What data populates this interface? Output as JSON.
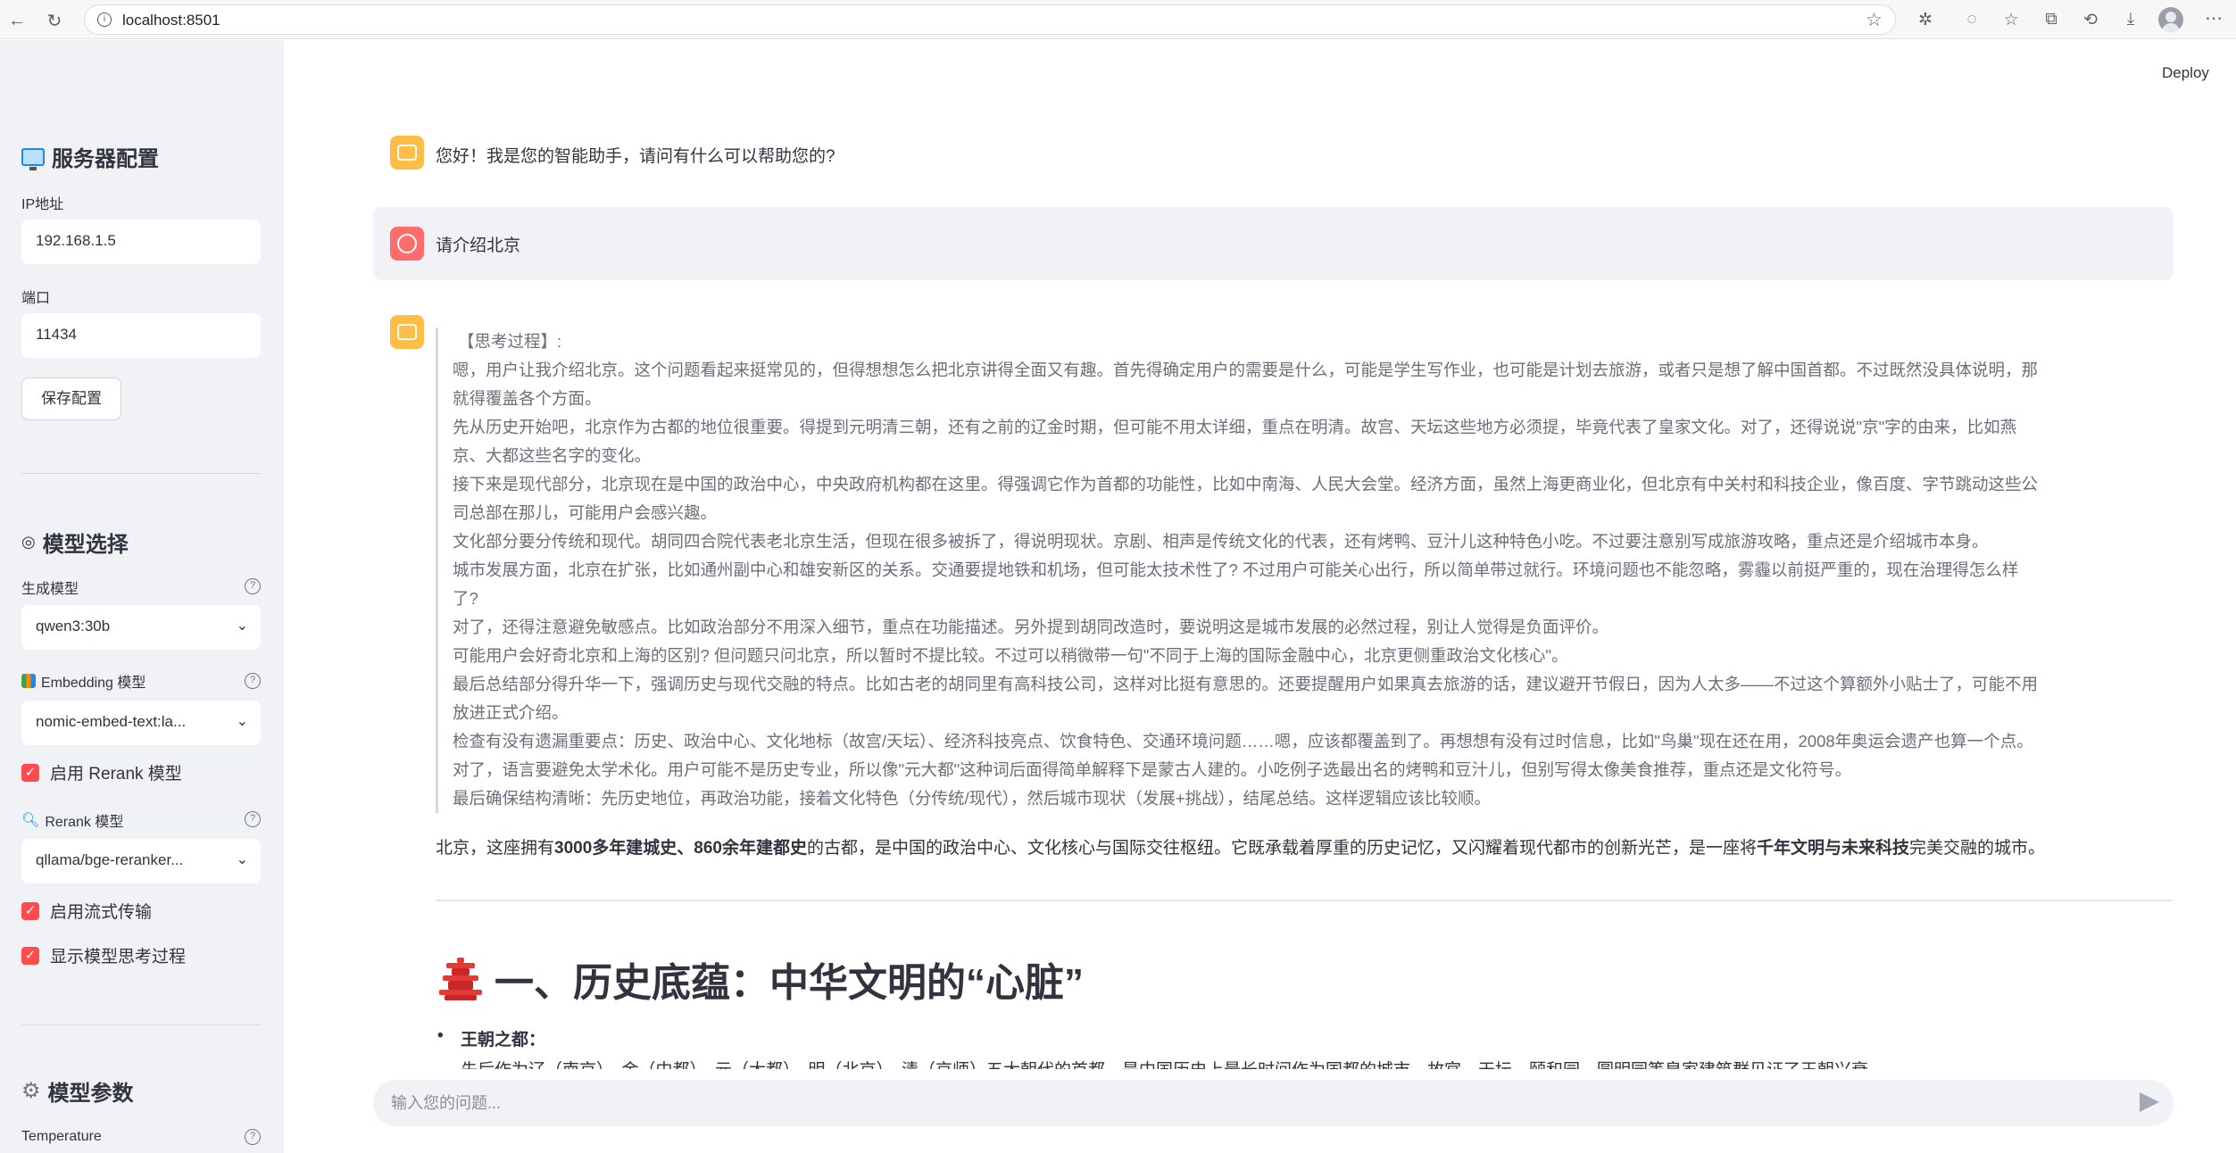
{
  "browser": {
    "url": "localhost:8501",
    "icons": [
      "back-icon",
      "reload-icon",
      "info-icon",
      "star-icon",
      "extensions-icon",
      "copilot-icon",
      "favorites-icon",
      "collections-icon",
      "history-icon",
      "downloads-icon",
      "profile-icon",
      "more-icon"
    ]
  },
  "header": {
    "deploy_label": "Deploy"
  },
  "sidebar": {
    "server_title": "服务器配置",
    "ip_label": "IP地址",
    "ip_value": "192.168.1.5",
    "port_label": "端口",
    "port_value": "11434",
    "save_label": "保存配置",
    "model_title": "模型选择",
    "gen_model_label": "生成模型",
    "gen_model_value": "qwen3:30b",
    "embed_label": "Embedding 模型",
    "embed_value": "nomic-embed-text:la...",
    "rerank_enable_label": "启用 Rerank 模型",
    "rerank_label": "Rerank 模型",
    "rerank_value": "qllama/bge-reranker...",
    "stream_label": "启用流式传输",
    "show_think_label": "显示模型思考过程",
    "params_title": "模型参数",
    "temperature_label": "Temperature"
  },
  "chat": {
    "greeting": "您好！我是您的智能助手，请问有什么可以帮助您的?",
    "user_msg": "请介绍北京",
    "think_lines": [
      "【思考过程】:",
      "嗯，用户让我介绍北京。这个问题看起来挺常见的，但得想想怎么把北京讲得全面又有趣。首先得确定用户的需要是什么，可能是学生写作业，也可能是计划去旅游，或者只是想了解中国首都。不过既然没具体说明，那",
      "就得覆盖各个方面。",
      "先从历史开始吧，北京作为古都的地位很重要。得提到元明清三朝，还有之前的辽金时期，但可能不用太详细，重点在明清。故宫、天坛这些地方必须提，毕竟代表了皇家文化。对了，还得说说\"京\"字的由来，比如燕",
      "京、大都这些名字的变化。",
      "接下来是现代部分，北京现在是中国的政治中心，中央政府机构都在这里。得强调它作为首都的功能性，比如中南海、人民大会堂。经济方面，虽然上海更商业化，但北京有中关村和科技企业，像百度、字节跳动这些公",
      "司总部在那儿，可能用户会感兴趣。",
      "文化部分要分传统和现代。胡同四合院代表老北京生活，但现在很多被拆了，得说明现状。京剧、相声是传统文化的代表，还有烤鸭、豆汁儿这种特色小吃。不过要注意别写成旅游攻略，重点还是介绍城市本身。",
      "城市发展方面，北京在扩张，比如通州副中心和雄安新区的关系。交通要提地铁和机场，但可能太技术性了? 不过用户可能关心出行，所以简单带过就行。环境问题也不能忽略，雾霾以前挺严重的，现在治理得怎么样",
      "了?",
      "对了，还得注意避免敏感点。比如政治部分不用深入细节，重点在功能描述。另外提到胡同改造时，要说明这是城市发展的必然过程，别让人觉得是负面评价。",
      "可能用户会好奇北京和上海的区别? 但问题只问北京，所以暂时不提比较。不过可以稍微带一句\"不同于上海的国际金融中心，北京更侧重政治文化核心\"。",
      "最后总结部分得升华一下，强调历史与现代交融的特点。比如古老的胡同里有高科技公司，这样对比挺有意思的。还要提醒用户如果真去旅游的话，建议避开节假日，因为人太多——不过这个算额外小贴士了，可能不用",
      "放进正式介绍。",
      "检查有没有遗漏重要点：历史、政治中心、文化地标（故宫/天坛）、经济科技亮点、饮食特色、交通环境问题……嗯，应该都覆盖到了。再想想有没有过时信息，比如\"鸟巢\"现在还在用，2008年奥运会遗产也算一个点。",
      "对了，语言要避免太学术化。用户可能不是历史专业，所以像\"元大都\"这种词后面得简单解释下是蒙古人建的。小吃例子选最出名的烤鸭和豆汁儿，但别写得太像美食推荐，重点还是文化符号。",
      "最后确保结构清晰：先历史地位，再政治功能，接着文化特色（分传统/现代），然后城市现状（发展+挑战），结尾总结。这样逻辑应该比较顺。"
    ],
    "answer_parts": {
      "p1": "北京，这座拥有",
      "b1": "3000多年建城史、860余年建都史",
      "p2": "的古都，是中国的政治中心、文化核心与国际交往枢纽。它既承载着厚重的历史记忆，又闪耀着现代都市的创新光芒，是一座将",
      "b2": "千年文明与未来科技",
      "p3": "完美交融的城市。"
    },
    "section_title": "一、历史底蕴：中华文明的“心脏”",
    "bullet_title": "王朝之都：",
    "cut_line": "先后作为辽（南京）、金（中都）、元（大都）、明（北京）、清（京师）五大朝代的首都，是中国历史上最长时间作为国都的城市，故宫、天坛、颐和园、圆明园等皇家建筑群见证了王朝兴衰。"
  },
  "input": {
    "placeholder": "输入您的问题..."
  }
}
